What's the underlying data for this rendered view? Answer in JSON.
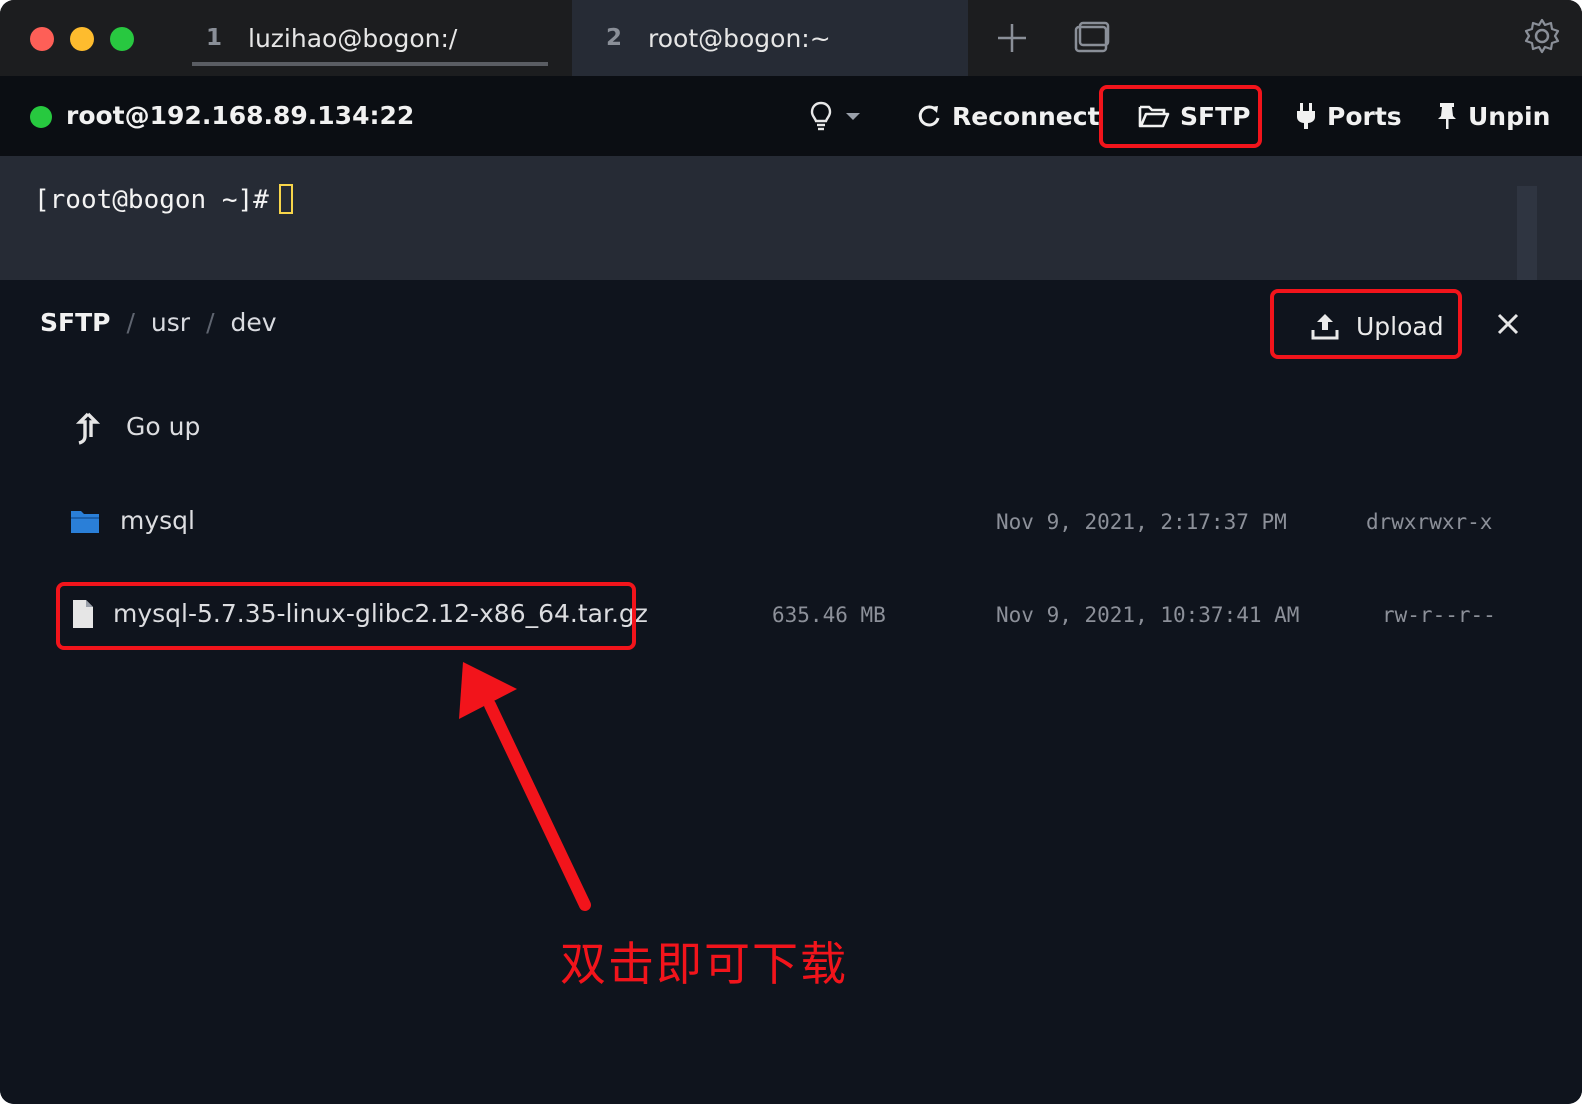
{
  "tabs": [
    {
      "num": "1",
      "label": "luzihao@bogon:/"
    },
    {
      "num": "2",
      "label": "root@bogon:~"
    }
  ],
  "toolbar": {
    "host": "root@192.168.89.134:22",
    "reconnect": "Reconnect",
    "sftp": "SFTP",
    "ports": "Ports",
    "unpin": "Unpin"
  },
  "terminal": {
    "prompt": "[root@bogon ~]#"
  },
  "sftp": {
    "breadcrumb": [
      "SFTP",
      "usr",
      "dev"
    ],
    "upload": "Upload",
    "go_up": "Go up",
    "files": [
      {
        "name": "mysql",
        "type": "folder",
        "size": "",
        "modified": "Nov 9, 2021, 2:17:37 PM",
        "perms": "drwxrwxr-x"
      },
      {
        "name": "mysql-5.7.35-linux-glibc2.12-x86_64.tar.gz",
        "type": "file",
        "size": "635.46 MB",
        "modified": "Nov 9, 2021, 10:37:41 AM",
        "perms": "rw-r--r--"
      }
    ]
  },
  "annotation": "双击即可下载",
  "colors": {
    "highlight": "#f2141b",
    "status_online": "#27c93f",
    "folder": "#2a7fd8"
  }
}
